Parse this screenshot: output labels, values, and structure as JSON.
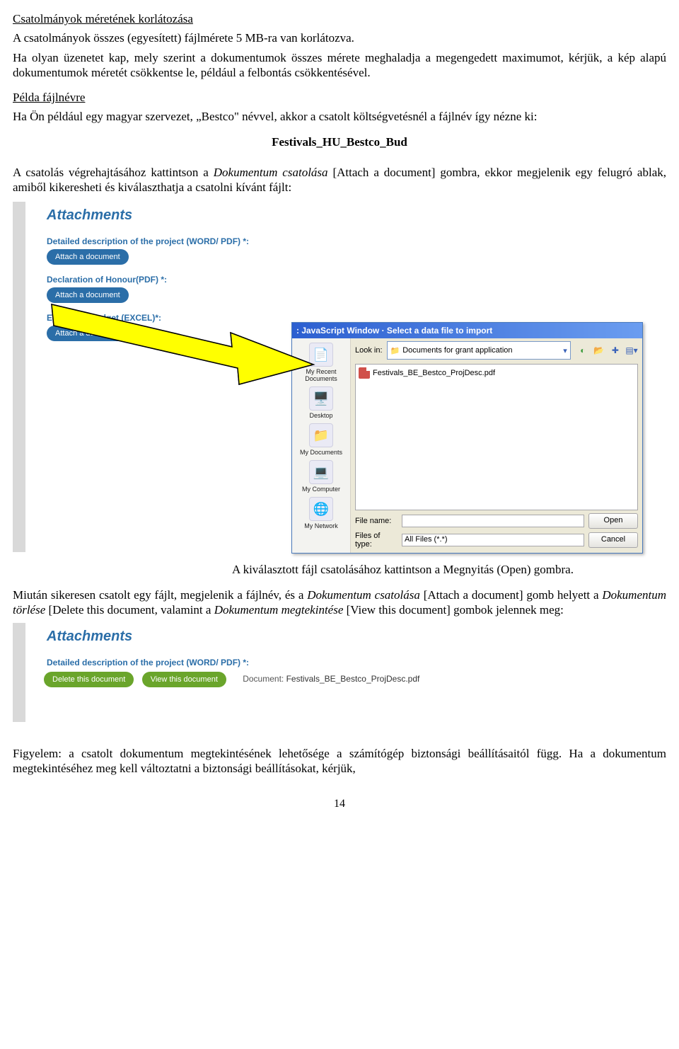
{
  "heading_1": "Csatolmányok méretének korlátozása",
  "para_1": "A csatolmányok összes (egyesített) fájlmérete 5 MB-ra van korlátozva.",
  "para_2": "Ha olyan üzenetet kap, mely szerint a dokumentumok összes mérete meghaladja a megengedett maximumot, kérjük, a kép alapú dokumentumok méretét csökkentse le, például a felbontás csökkentésével.",
  "heading_2": "Példa fájlnévre",
  "para_3": "Ha Ön például egy magyar szervezet, „Bestco\" névvel, akkor a csatolt költségvetésnél a fájlnév így nézne ki:",
  "example_filename": "Festivals_HU_Bestco_Bud",
  "para_4a": "A csatolás végrehajtásához kattintson a ",
  "para_4b": "Dokumentum csatolása",
  "para_4c": " [Attach a document] gombra, ekkor megjelenik egy felugró ablak, amiből kikeresheti és kiválaszthatja a csatolni kívánt fájlt:",
  "attachments_title": "Attachments",
  "label_detailed": "Detailed description of the project (WORD/ PDF) *:",
  "label_declaration": "Declaration of Honour(PDF) *:",
  "label_budget": "Estimated Budget (EXCEL)*:",
  "attach_btn": "Attach a document",
  "dlg_title": ": JavaScript Window · Select a data file to import",
  "lookin_label": "Look in:",
  "lookin_value": "Documents for grant application",
  "places": {
    "recent": "My Recent Documents",
    "desktop": "Desktop",
    "mydocs": "My Documents",
    "mycomp": "My Computer",
    "mynet": "My Network"
  },
  "file_in_list": "Festivals_BE_Bestco_ProjDesc.pdf",
  "filename_label": "File name:",
  "filetype_label": "Files of type:",
  "filetype_value": "All Files (*.*)",
  "open_btn": "Open",
  "cancel_btn": "Cancel",
  "caption_1": "A kiválasztott fájl csatolásához kattintson a Megnyitás (Open) gombra.",
  "para_5_full": "Miután sikeresen csatolt egy fájlt, megjelenik a fájlnév, és a Dokumentum csatolása [Attach a document] gomb helyett a Dokumentum törlése [Delete this document, valamint a Dokumentum megtekintése [View this document] gombok jelennek meg:",
  "para_5a": "Miután sikeresen csatolt egy fájlt, megjelenik a fájlnév, és a ",
  "para_5b": "Dokumentum csatolása",
  "para_5c": " [Attach a document] gomb helyett a ",
  "para_5d": "Dokumentum törlése",
  "para_5e": " [Delete this document, valamint a ",
  "para_5f": "Dokumentum megtekintése",
  "para_5g": " [View this document] gombok jelennek meg:",
  "delete_btn": "Delete this document",
  "view_btn": "View this document",
  "doc_label": "Document:",
  "doc_name": "Festivals_BE_Bestco_ProjDesc.pdf",
  "para_6": "Figyelem: a csatolt dokumentum megtekintésének lehetősége a számítógép biztonsági beállításaitól függ. Ha a dokumentum megtekintéséhez meg kell változtatni a biztonsági beállításokat, kérjük,",
  "page_number": "14"
}
